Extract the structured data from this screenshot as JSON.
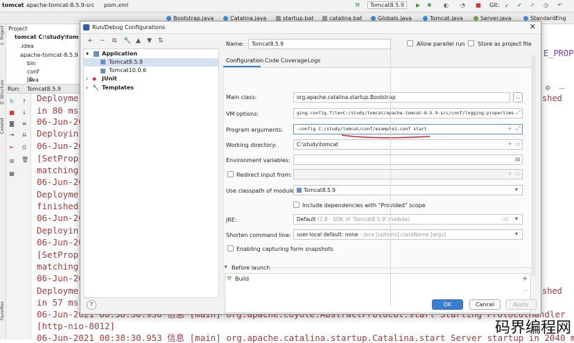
{
  "topbar": {
    "crumbs": [
      "tomcat",
      "apache-tomcat-8.5.9-src",
      "pom.xml"
    ],
    "run_config": "Tomcat8.5.9",
    "git_label": "Git:"
  },
  "tabs": [
    "Bootstrap.java",
    "Catalina.java",
    "startup.bat",
    "catalina.bat",
    "Globals.java",
    "Tomcat.java",
    "Server.java",
    "StandardEng"
  ],
  "left_tool_labels": [
    "1: Project",
    "Z: Structure",
    "Commit",
    "Favorites"
  ],
  "project": {
    "header": "Project",
    "rows": [
      "tomcat  C:\\study\\tom",
      ".idea",
      "apache-tomcat-8.5.9",
      "bin",
      "conf",
      "java",
      "lib"
    ]
  },
  "run": {
    "label": "Run:",
    "tab": "Tomcat8.5.9"
  },
  "console": {
    "lines": [
      "Deployme",
      "in 80 ms",
      "06-Jun-20",
      "Deployin",
      "06-Jun-20",
      "[SetProp",
      "matching",
      "06-Jun-20",
      "Deployme",
      "finished",
      "06-Jun-20",
      "Deployin",
      "06-Jun-20",
      "[SetProp",
      "matching",
      "06-Jun-20",
      "Deployme",
      "in 57 ms",
      "06-Jun-2021 00:38:30.950 信息 [main] org.apache.coyote.AbstractProtocol.start Starting ProtocolHandler",
      "[http-nio-8012]",
      "06-Jun-2021 00:38:30.953 信息 [main] org.apache.catalina.startup.Catalina.start Server startup in 2040 ms"
    ],
    "right_fragments": [
      "E_PROP)",
      "shed",
      "shed"
    ]
  },
  "dialog": {
    "title": "Run/Debug Configurations",
    "toolbar": [
      "+",
      "−",
      "⧉",
      "🔧",
      "▲",
      "▼",
      "⇅"
    ],
    "tree": {
      "application": "Application",
      "items": [
        "Tomcat8.5.9",
        "Tomcat10.0.6"
      ],
      "junit": "JUnit",
      "templates": "Templates"
    },
    "name_label": "Name:",
    "name_value": "Tomcat8.5.9",
    "allow_parallel": "Allow parallel run",
    "store_as_file": "Store as project file",
    "tabs": [
      "Configuration",
      "Code Coverage",
      "Logs"
    ],
    "main_class_label": "Main class:",
    "main_class_value": "org.apache.catalina.startup.Bootstrap",
    "vm_options_label": "VM options:",
    "vm_options_value": "ging.config.file=C:/study/tomcat/apache-tomcat-8.5.9-src/conf/logging.properties",
    "program_args_label": "Program arguments:",
    "program_args_value": "-config C:/study/tomcat/conf/example1.conf start",
    "working_dir_label": "Working directory:",
    "working_dir_value": "C:\\study\\tomcat",
    "env_vars_label": "Environment variables:",
    "redirect_label": "Redirect input from:",
    "classpath_label": "Use classpath of module:",
    "classpath_value": "Tomcat8.5.9",
    "include_deps": "Include dependencies with \"Provided\" scope",
    "jre_label": "JRE:",
    "jre_value": "Default",
    "jre_hint": "(1.8 - SDK of 'Tomcat8.5.9' module)",
    "shorten_label": "Shorten command line:",
    "shorten_value": "user-local default: none",
    "shorten_hint": "- java [options] className [args]",
    "snapshots": "Enabling capturing form snapshots",
    "before_launch": "Before launch",
    "build": "Build",
    "help": "?",
    "ok": "OK",
    "cancel": "Cancel",
    "apply": "Apply",
    "accent": "#3a7ed1",
    "underline_color": "#d02020"
  },
  "watermark": "码界编程网"
}
